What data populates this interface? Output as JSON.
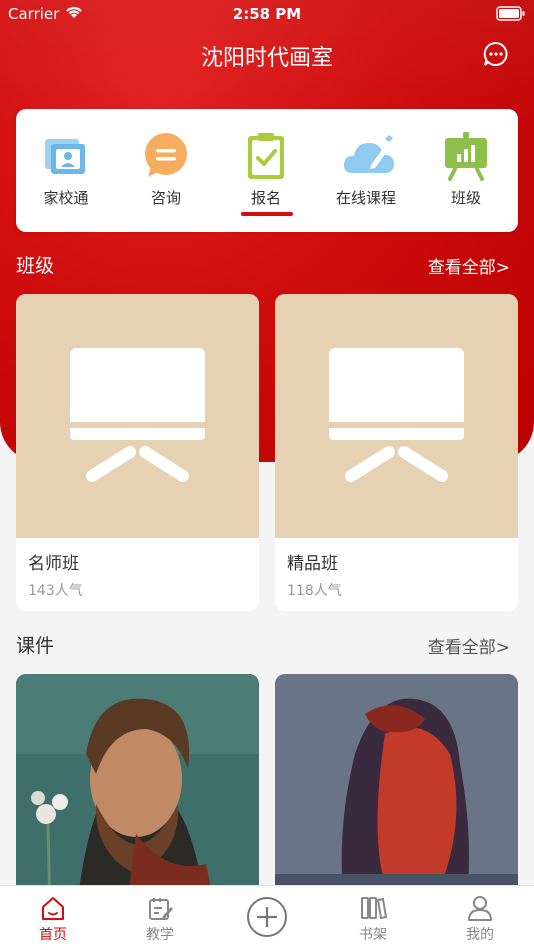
{
  "status": {
    "carrier": "Carrier",
    "time": "2:58 PM"
  },
  "header": {
    "title": "沈阳时代画室"
  },
  "quick_nav": [
    {
      "label": "家校通"
    },
    {
      "label": "咨询"
    },
    {
      "label": "报名"
    },
    {
      "label": "在线课程"
    },
    {
      "label": "班级"
    }
  ],
  "classes_section": {
    "title": "班级",
    "more": "查看全部>",
    "items": [
      {
        "name": "名师班",
        "popularity": "143人气"
      },
      {
        "name": "精品班",
        "popularity": "118人气"
      }
    ]
  },
  "courses_section": {
    "title": "课件",
    "more": "查看全部>"
  },
  "tabbar": [
    {
      "label": "首页"
    },
    {
      "label": "教学"
    },
    {
      "label": ""
    },
    {
      "label": "书架"
    },
    {
      "label": "我的"
    }
  ],
  "colors": {
    "brand": "#d30c0c",
    "class_thumb": "#e6d1b2"
  }
}
